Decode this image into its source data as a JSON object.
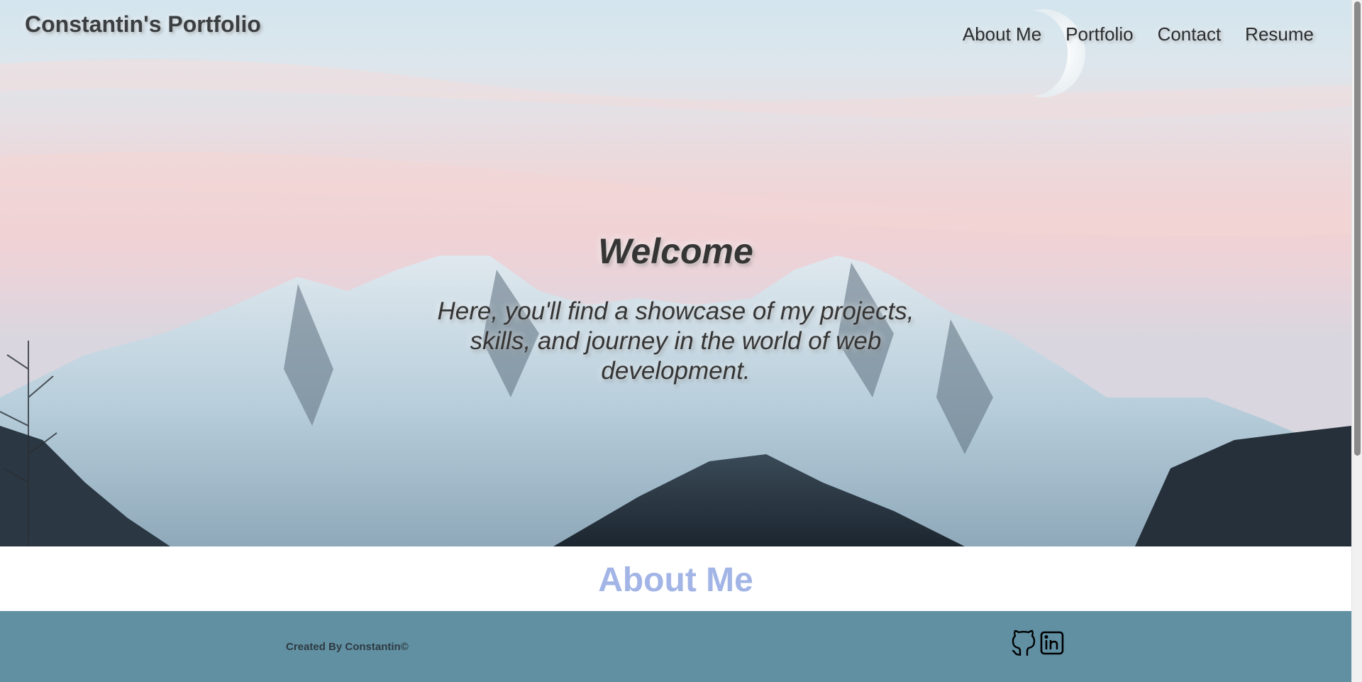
{
  "header": {
    "site_title": "Constantin's Portfolio",
    "nav": [
      "About Me",
      "Portfolio",
      "Contact",
      "Resume"
    ]
  },
  "hero": {
    "heading": "Welcome",
    "text": "Here, you'll find a showcase of my projects, skills, and journey in the world of web development."
  },
  "about": {
    "heading": "About Me"
  },
  "footer": {
    "credit": "Created By Constantin©",
    "social": [
      {
        "name": "github-icon"
      },
      {
        "name": "linkedin-icon"
      }
    ]
  },
  "colors": {
    "about_heading": "#a3b5e6",
    "footer_bg": "#6190a3",
    "text_dark": "#353535"
  }
}
